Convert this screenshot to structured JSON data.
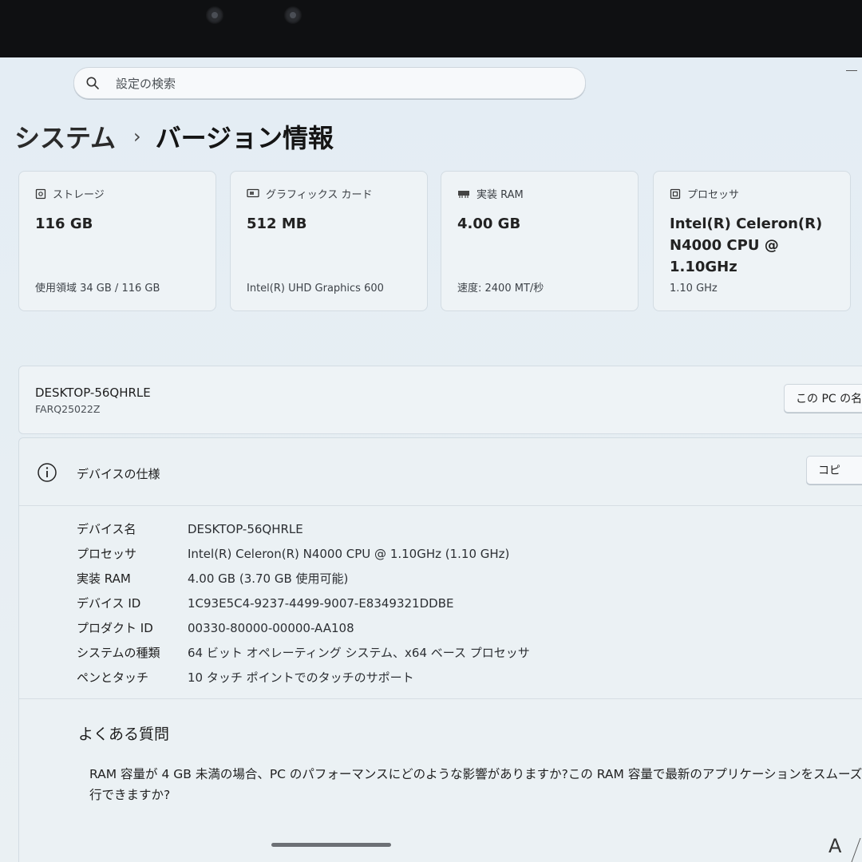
{
  "search": {
    "placeholder": "設定の検索",
    "icon": "search-icon"
  },
  "breadcrumb": {
    "parent": "システム",
    "separator": "›",
    "current": "バージョン情報"
  },
  "cards": [
    {
      "title": "ストレージ",
      "icon": "storage-icon",
      "value": "116 GB",
      "sub": "使用領域 34 GB / 116 GB"
    },
    {
      "title": "グラフィックス カード",
      "icon": "graphics-card-icon",
      "value": "512 MB",
      "sub": "Intel(R) UHD Graphics 600"
    },
    {
      "title": "実装 RAM",
      "icon": "ram-icon",
      "value": "4.00 GB",
      "sub": "速度: 2400 MT/秒"
    },
    {
      "title": "プロセッサ",
      "icon": "processor-icon",
      "value": "Intel(R) Celeron(R) N4000 CPU @ 1.10GHz",
      "sub": "1.10 GHz"
    }
  ],
  "pc": {
    "name": "DESKTOP-56QHRLE",
    "model": "FARQ25022Z",
    "rename_label": "この PC の名"
  },
  "specs": {
    "title": "デバイスの仕様",
    "copy_label": "コピ",
    "rows": [
      {
        "key": "デバイス名",
        "value": "DESKTOP-56QHRLE"
      },
      {
        "key": "プロセッサ",
        "value": "Intel(R) Celeron(R) N4000 CPU @ 1.10GHz (1.10 GHz)"
      },
      {
        "key": "実装 RAM",
        "value": "4.00 GB (3.70 GB 使用可能)"
      },
      {
        "key": "デバイス ID",
        "value": "1C93E5C4-9237-4499-9007-E8349321DDBE"
      },
      {
        "key": "プロダクト ID",
        "value": "00330-80000-00000-AA108"
      },
      {
        "key": "システムの種類",
        "value": "64 ビット オペレーティング システム、x64 ベース プロセッサ"
      },
      {
        "key": "ペンとタッチ",
        "value": "10 タッチ ポイントでのタッチのサポート"
      }
    ]
  },
  "faq": {
    "title": "よくある質問",
    "question": "RAM 容量が 4 GB 未満の場合、PC のパフォーマンスにどのような影響がありますか?この RAM 容量で最新のアプリケーションをスムーズに実行できますか?"
  },
  "corner": {
    "letter": "A"
  }
}
